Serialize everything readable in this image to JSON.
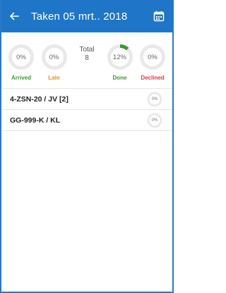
{
  "header": {
    "title": "Taken 05 mrt.. 2018",
    "back_icon": "arrow-left-icon",
    "calendar_icon": "calendar-icon",
    "color": "#1f76c8"
  },
  "stats": {
    "arrived": {
      "value": "0%",
      "label": "Arrived",
      "fraction": 0,
      "color": "#3a9a2c"
    },
    "late": {
      "value": "0%",
      "label": "Late",
      "fraction": 0,
      "color": "#f28a1e"
    },
    "total": {
      "label": "Total",
      "count": "8"
    },
    "done": {
      "value": "12%",
      "label": "Done",
      "fraction": 0.12,
      "color": "#3a9a2c"
    },
    "declined": {
      "value": "0%",
      "label": "Declined",
      "fraction": 0,
      "color": "#e03a3a"
    }
  },
  "tasks": [
    {
      "name": "4-ZSN-20 / JV [2]",
      "progress": "0%"
    },
    {
      "name": "GG-999-K /  KL",
      "progress": "0%"
    }
  ]
}
